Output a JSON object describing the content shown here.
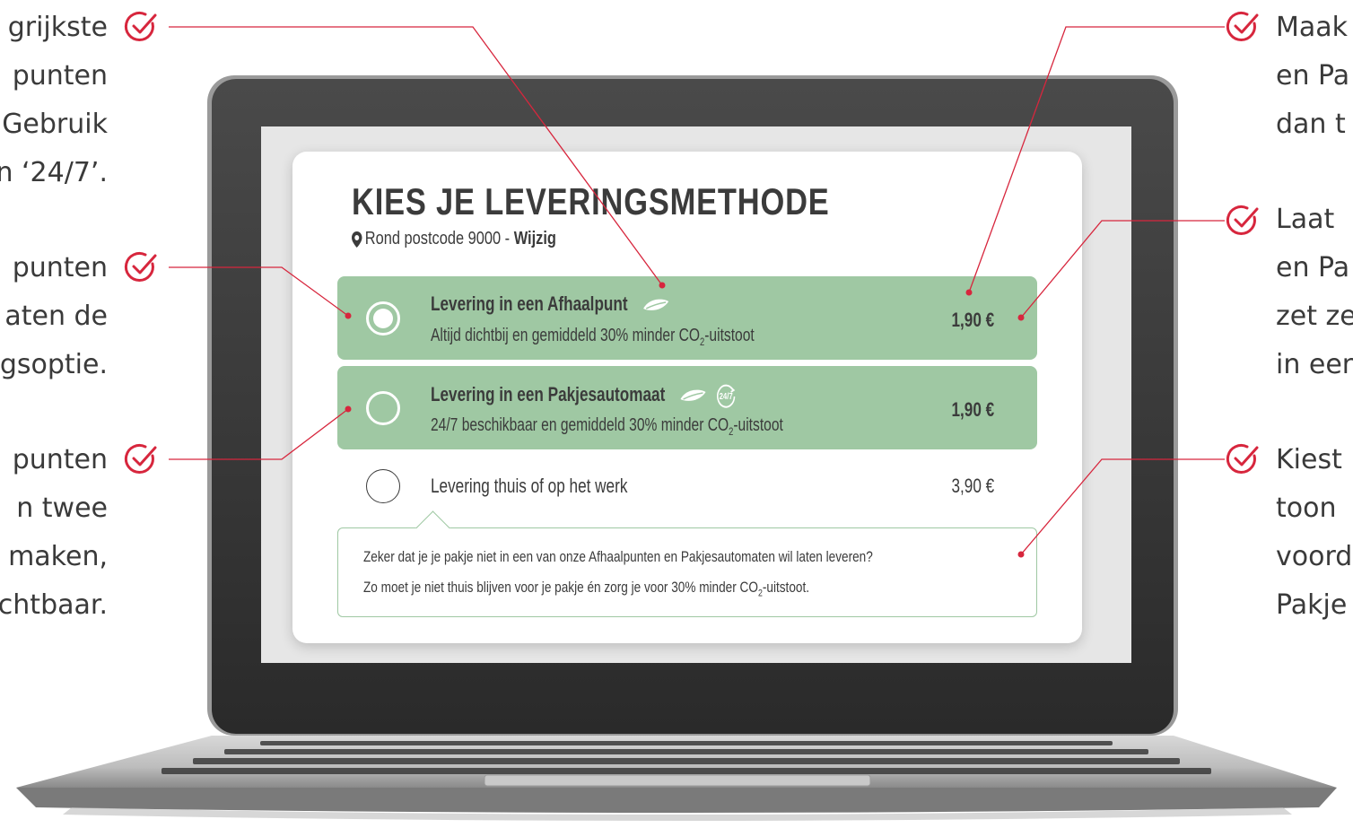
{
  "colors": {
    "accent": "#d7263d",
    "option_green": "#9fc8a3",
    "text": "#3b3b3b"
  },
  "left_annotations": [
    {
      "lines": [
        "grijkste",
        "punten",
        "Gebruik",
        "n ‘24/7’."
      ]
    },
    {
      "lines": [
        "punten",
        "aten de",
        "gsoptie."
      ]
    },
    {
      "lines": [
        "punten",
        "n twee",
        "maken,",
        "chtbaar."
      ]
    }
  ],
  "right_annotations": [
    {
      "lines": [
        "Maak",
        "en Pa",
        "dan t"
      ]
    },
    {
      "lines": [
        "Laat",
        "en Pa",
        "zet ze",
        "in een"
      ]
    },
    {
      "lines": [
        "Kiest",
        "toon",
        "voord",
        "Pakje"
      ]
    }
  ],
  "screen": {
    "title": "KIES JE LEVERINGSMETHODE",
    "location_prefix": "Rond postcode 9000 - ",
    "location_link": "Wijzig",
    "options": [
      {
        "title": "Levering in een Afhaalpunt",
        "subtitle": "Altijd dichtbij en gemiddeld 30% minder CO",
        "subtitle_sub": "2",
        "subtitle_end": "-uitstoot",
        "price": "1,90 €",
        "icons": [
          "leaf-icon"
        ],
        "selected": true
      },
      {
        "title": "Levering in een Pakjesautomaat",
        "subtitle": "24/7 beschikbaar en gemiddeld 30% minder CO",
        "subtitle_sub": "2",
        "subtitle_end": "-uitstoot",
        "price": "1,90 €",
        "icons": [
          "leaf-icon",
          "24-7-icon"
        ],
        "badge": "24/7",
        "selected": false
      },
      {
        "title": "Levering thuis of op het werk",
        "price": "3,90 €",
        "selected": false
      }
    ],
    "tooltip": {
      "line1": "Zeker dat je je pakje niet in een van onze Afhaalpunten en Pakjesautomaten wil laten leveren?",
      "line2": "Zo moet je niet thuis blijven voor je pakje én zorg je voor 30% minder CO",
      "line2_sub": "2",
      "line2_end": "-uitstoot."
    }
  }
}
